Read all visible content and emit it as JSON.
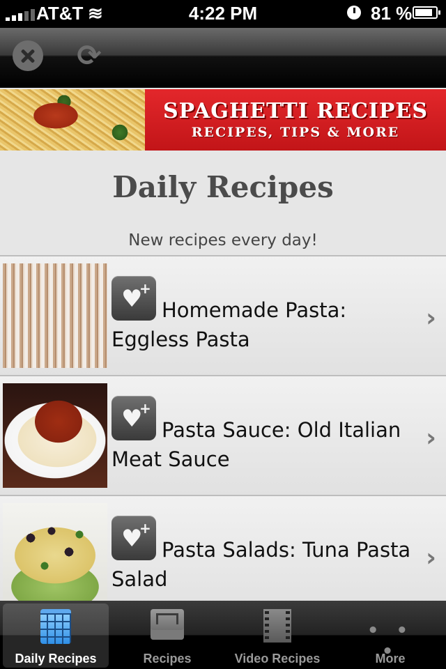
{
  "status_bar": {
    "carrier": "AT&T",
    "time": "4:22 PM",
    "battery": "81 %"
  },
  "toolbar": {
    "close_icon": "close-circle-icon",
    "refresh_icon": "refresh-icon"
  },
  "banner": {
    "title": "SPAGHETTI RECIPES",
    "subtitle": "RECIPES, TIPS & MORE"
  },
  "header": {
    "title": "Daily Recipes",
    "subtitle": "New recipes every day!"
  },
  "recipes": [
    {
      "title": "Homemade Pasta: Eggless Pasta"
    },
    {
      "title": "Pasta Sauce: Old Italian Meat Sauce"
    },
    {
      "title": "Pasta Salads: Tuna Pasta Salad"
    }
  ],
  "tabs": [
    {
      "label": "Daily Recipes",
      "icon": "calendar-icon",
      "active": true
    },
    {
      "label": "Recipes",
      "icon": "tray-icon",
      "active": false
    },
    {
      "label": "Video Recipes",
      "icon": "film-icon",
      "active": false
    },
    {
      "label": "More",
      "icon": "more-icon",
      "active": false
    }
  ],
  "colors": {
    "banner_red": "#d11d21",
    "active_tab": "#2f8fe6"
  }
}
